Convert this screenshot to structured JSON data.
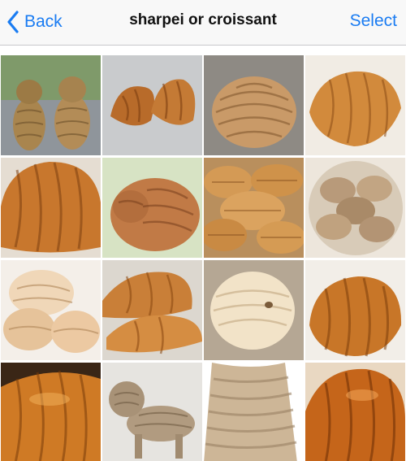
{
  "navbar": {
    "back_label": "Back",
    "title": "sharpei or croissant",
    "select_label": "Select",
    "accent_color": "#1a7cf2"
  },
  "icons": {
    "back": "chevron-left-icon"
  },
  "photos": [
    {
      "subject": "sharpei",
      "scene": "two-puppies-sitting"
    },
    {
      "subject": "croissant",
      "scene": "two-croissants-grey"
    },
    {
      "subject": "sharpei",
      "scene": "curled-dog"
    },
    {
      "subject": "croissant",
      "scene": "single-croissant-light"
    },
    {
      "subject": "croissant",
      "scene": "large-croissant"
    },
    {
      "subject": "sharpei",
      "scene": "sleeping-puppy-on-blanket"
    },
    {
      "subject": "croissant",
      "scene": "pile-of-croissants"
    },
    {
      "subject": "sharpei",
      "scene": "litter-of-puppies"
    },
    {
      "subject": "sharpei",
      "scene": "cream-puppies-stacked"
    },
    {
      "subject": "croissant",
      "scene": "croissants-stacked"
    },
    {
      "subject": "sharpei",
      "scene": "cream-puppy-on-rug"
    },
    {
      "subject": "croissant",
      "scene": "croissant-close-up"
    },
    {
      "subject": "croissant",
      "scene": "glazed-croissant"
    },
    {
      "subject": "sharpei",
      "scene": "standing-wrinkly-dog"
    },
    {
      "subject": "sharpei",
      "scene": "wrinkly-skin-close-up"
    },
    {
      "subject": "croissant",
      "scene": "shiny-croissant"
    }
  ]
}
